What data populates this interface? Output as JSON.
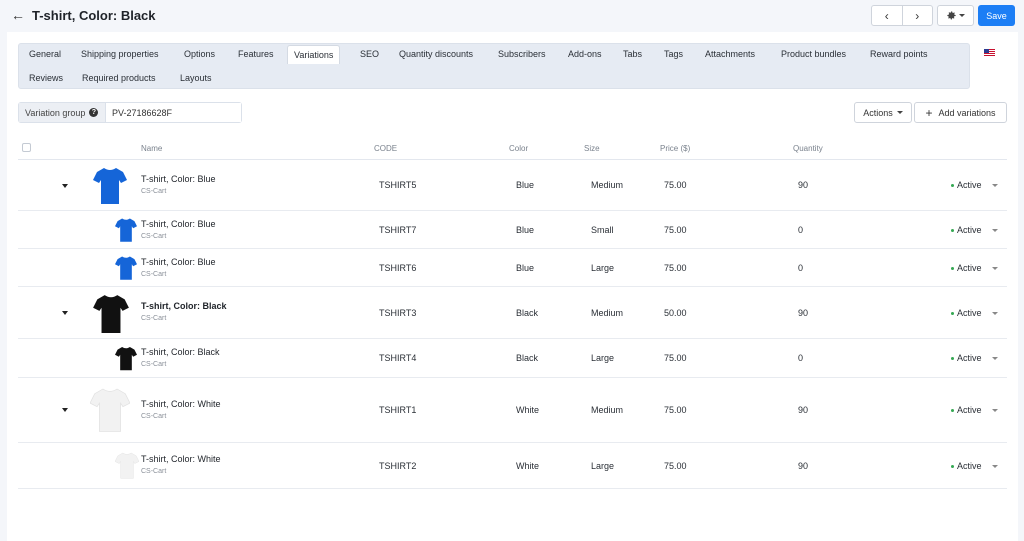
{
  "header": {
    "title": "T-shirt, Color: Black",
    "save_label": "Save",
    "icons": {
      "back": "arrow-left-icon",
      "prev": "chevron-left-icon",
      "next": "chevron-right-icon",
      "settings": "gear-icon"
    }
  },
  "tabs": [
    {
      "label": "General"
    },
    {
      "label": "Shipping properties"
    },
    {
      "label": "Options"
    },
    {
      "label": "Features"
    },
    {
      "label": "Variations",
      "active": true
    },
    {
      "label": "SEO"
    },
    {
      "label": "Quantity discounts"
    },
    {
      "label": "Subscribers"
    },
    {
      "label": "Add-ons"
    },
    {
      "label": "Tabs"
    },
    {
      "label": "Tags"
    },
    {
      "label": "Attachments"
    },
    {
      "label": "Product bundles"
    },
    {
      "label": "Reward points"
    },
    {
      "label": "Reviews"
    },
    {
      "label": "Required products"
    },
    {
      "label": "Layouts"
    }
  ],
  "variation_group": {
    "label": "Variation group",
    "value": "PV-27186628F"
  },
  "toolbar": {
    "actions_label": "Actions",
    "add_variations_label": "Add variations"
  },
  "table": {
    "columns": {
      "name": "Name",
      "code": "CODE",
      "color": "Color",
      "size": "Size",
      "price": "Price ($)",
      "quantity": "Quantity"
    },
    "rows": [
      {
        "name": "T-shirt, Color: Blue",
        "vendor": "CS-Cart",
        "code": "TSHIRT5",
        "color": "Blue",
        "size": "Medium",
        "price": "75.00",
        "quantity": "90",
        "status": "Active"
      },
      {
        "name": "T-shirt, Color: Blue",
        "vendor": "CS-Cart",
        "code": "TSHIRT7",
        "color": "Blue",
        "size": "Small",
        "price": "75.00",
        "quantity": "0",
        "status": "Active"
      },
      {
        "name": "T-shirt, Color: Blue",
        "vendor": "CS-Cart",
        "code": "TSHIRT6",
        "color": "Blue",
        "size": "Large",
        "price": "75.00",
        "quantity": "0",
        "status": "Active"
      },
      {
        "name": "T-shirt, Color: Black",
        "vendor": "CS-Cart",
        "code": "TSHIRT3",
        "color": "Black",
        "size": "Medium",
        "price": "50.00",
        "quantity": "90",
        "status": "Active"
      },
      {
        "name": "T-shirt, Color: Black",
        "vendor": "CS-Cart",
        "code": "TSHIRT4",
        "color": "Black",
        "size": "Large",
        "price": "75.00",
        "quantity": "0",
        "status": "Active"
      },
      {
        "name": "T-shirt, Color: White",
        "vendor": "CS-Cart",
        "code": "TSHIRT1",
        "color": "White",
        "size": "Medium",
        "price": "75.00",
        "quantity": "90",
        "status": "Active"
      },
      {
        "name": "T-shirt, Color: White",
        "vendor": "CS-Cart",
        "code": "TSHIRT2",
        "color": "White",
        "size": "Large",
        "price": "75.00",
        "quantity": "90",
        "status": "Active"
      }
    ]
  },
  "colors": {
    "accent": "#1c7ef5",
    "status_active": "#35a853",
    "blue_shirt": "#1565d8",
    "black_shirt": "#111111",
    "white_shirt": "#f2f2f2"
  }
}
